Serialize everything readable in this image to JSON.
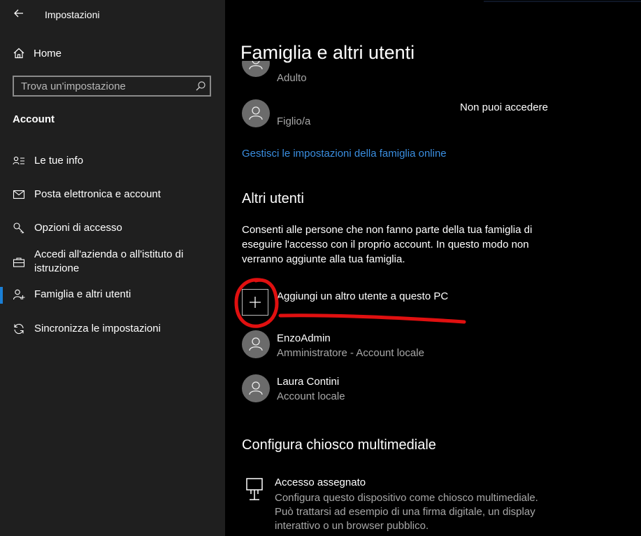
{
  "sidebar": {
    "app_title": "Impostazioni",
    "home_label": "Home",
    "search_placeholder": "Trova un'impostazione",
    "section_title": "Account",
    "items": [
      {
        "label": "Le tue info",
        "icon": "user-info-icon"
      },
      {
        "label": "Posta elettronica e account",
        "icon": "mail-icon"
      },
      {
        "label": "Opzioni di accesso",
        "icon": "key-icon"
      },
      {
        "label": "Accedi all'azienda o all'istituto di istruzione",
        "icon": "briefcase-icon"
      },
      {
        "label": "Famiglia e altri utenti",
        "icon": "add-user-icon",
        "selected": true
      },
      {
        "label": "Sincronizza le impostazioni",
        "icon": "sync-icon"
      }
    ],
    "accent_color": "#1a7fd6"
  },
  "main": {
    "title": "Famiglia e altri utenti",
    "family": [
      {
        "name": "",
        "role": "Adulto",
        "status": ""
      },
      {
        "name": "",
        "role": "Figlio/a",
        "status": "Non puoi accedere"
      }
    ],
    "family_link": "Gestisci le impostazioni della famiglia online",
    "others_title": "Altri utenti",
    "others_desc": "Consenti alle persone che non fanno parte della tua famiglia di eseguire l'accesso con il proprio account. In questo modo non verranno aggiunte alla tua famiglia.",
    "add_user_label": "Aggiungi un altro utente a questo PC",
    "other_users": [
      {
        "name": "EnzoAdmin",
        "role": "Amministratore - Account locale"
      },
      {
        "name": "Laura Contini",
        "role": "Account locale"
      }
    ],
    "kiosk_title": "Configura chiosco multimediale",
    "kiosk_item_title": "Accesso assegnato",
    "kiosk_item_desc": "Configura questo dispositivo come chiosco multimediale. Può trattarsi ad esempio di una firma digitale, un display interattivo o un browser pubblico.",
    "link_color": "#3a8ee0",
    "annotation_color": "#e01010"
  }
}
